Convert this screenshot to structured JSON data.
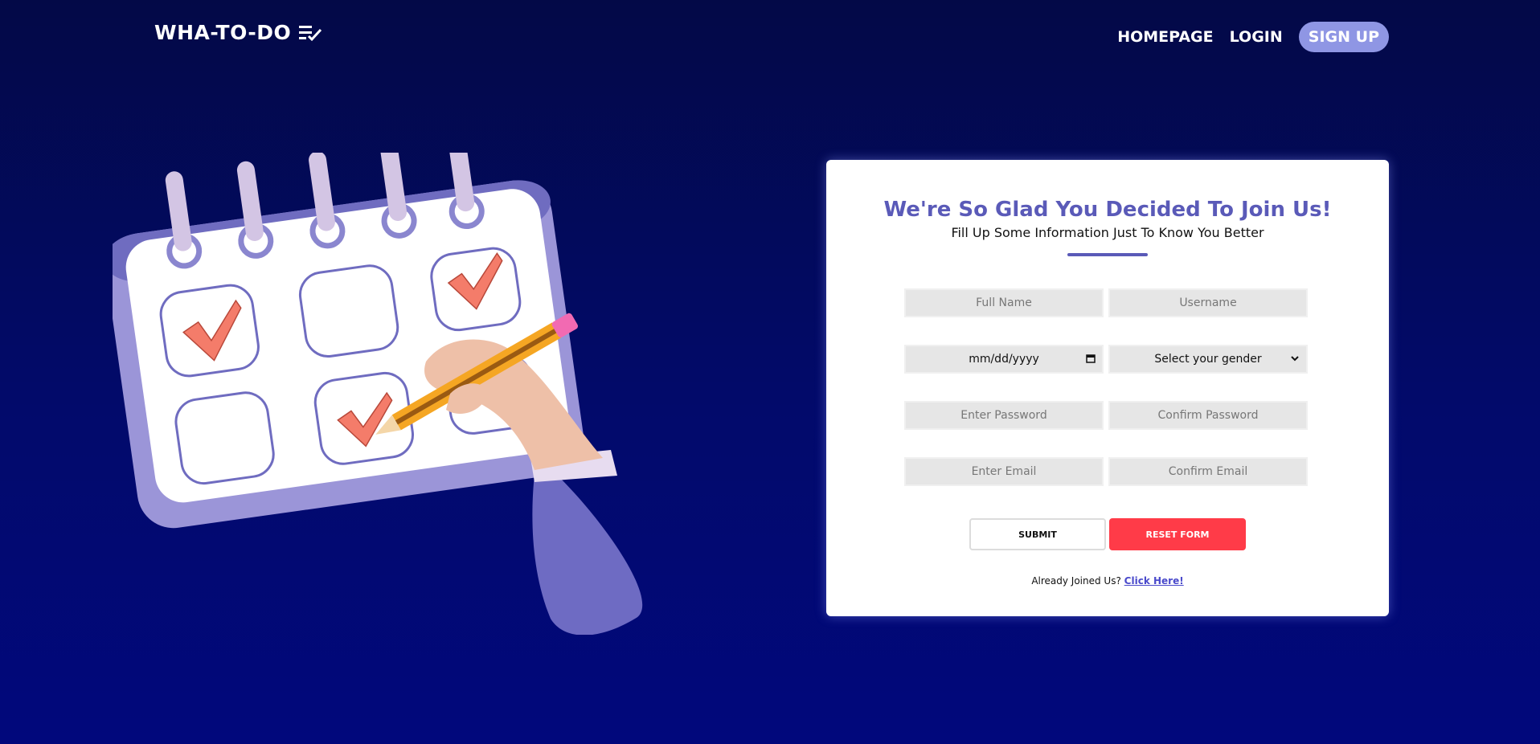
{
  "brand": {
    "title": "WHA-TO-DO",
    "icon": "checklist-icon"
  },
  "nav": {
    "homepage": "HOMEPAGE",
    "login": "LOGIN",
    "signup": "SIGN UP"
  },
  "form": {
    "title": "We're So Glad You Decided To Join Us!",
    "subtitle": "Fill Up Some Information Just To Know You Better",
    "fullname_placeholder": "Full Name",
    "username_placeholder": "Username",
    "dob_placeholder": "mm/dd/yyyy",
    "gender_selected": "Select your gender",
    "password_placeholder": "Enter Password",
    "confirm_password_placeholder": "Confirm Password",
    "email_placeholder": "Enter Email",
    "confirm_email_placeholder": "Confirm Email",
    "submit_label": "SUBMIT",
    "reset_label": "RESET FORM",
    "already_text": "Already Joined Us?",
    "click_here": "Click Here!"
  },
  "colors": {
    "background_top": "#030947",
    "background_bottom": "#01087c",
    "accent": "#5a5ab8",
    "signup_bg": "#8f96e4",
    "reset_bg": "#ff3b48"
  }
}
